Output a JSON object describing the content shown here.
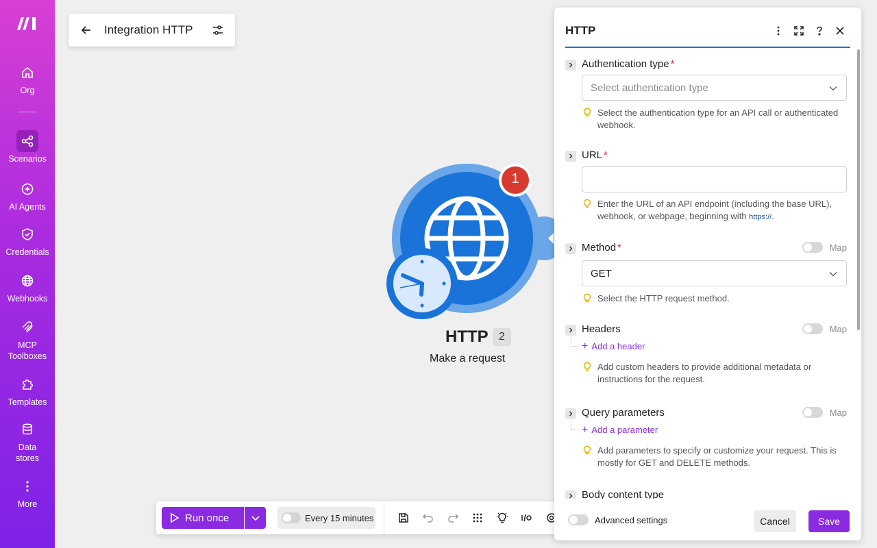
{
  "sidebar": {
    "logo": "make-logo",
    "items": [
      {
        "label": "Org",
        "icon": "home-icon"
      },
      {
        "label": "Scenarios",
        "icon": "share-icon"
      },
      {
        "label": "AI Agents",
        "icon": "ai-agent-icon"
      },
      {
        "label": "Credentials",
        "icon": "shield-check-icon"
      },
      {
        "label": "Webhooks",
        "icon": "globe-icon"
      },
      {
        "label": "MCP Toolboxes",
        "icon": "mcp-icon"
      },
      {
        "label": "Templates",
        "icon": "puzzle-icon"
      },
      {
        "label": "Data stores",
        "icon": "database-icon"
      },
      {
        "label": "More",
        "icon": "more-vertical-icon"
      }
    ],
    "active": "Scenarios"
  },
  "header": {
    "title": "Integration HTTP"
  },
  "module": {
    "name": "HTTP",
    "count": "2",
    "subtitle": "Make a request",
    "badge": "1",
    "color": "#1a73d8"
  },
  "toolbar": {
    "run_label": "Run once",
    "schedule_label": "Every 15 minutes"
  },
  "panel": {
    "title": "HTTP",
    "fields": {
      "auth": {
        "label": "Authentication type",
        "placeholder": "Select authentication type",
        "hint": "Select the authentication type for an API call or authenticated webhook."
      },
      "url": {
        "label": "URL",
        "value": "",
        "hint": "Enter the URL of an API endpoint (including the base URL), webhook, or webpage, beginning with",
        "hint_code": "https://",
        "hint_end": "."
      },
      "method": {
        "label": "Method",
        "value": "GET",
        "map": "Map",
        "hint": "Select the HTTP request method."
      },
      "headers": {
        "label": "Headers",
        "map": "Map",
        "add": "Add a header",
        "hint": "Add custom headers to provide additional metadata or instructions for the request."
      },
      "query": {
        "label": "Query parameters",
        "map": "Map",
        "add": "Add a parameter",
        "hint": "Add parameters to specify or customize your request. This is mostly for GET and DELETE methods."
      },
      "body": {
        "label": "Body content type"
      }
    },
    "advanced_label": "Advanced settings",
    "cancel_label": "Cancel",
    "save_label": "Save"
  },
  "colors": {
    "accent": "#8a2be2",
    "required": "#e0245e",
    "http_blue": "#1a73d8",
    "badge_red": "#d93a2f"
  }
}
